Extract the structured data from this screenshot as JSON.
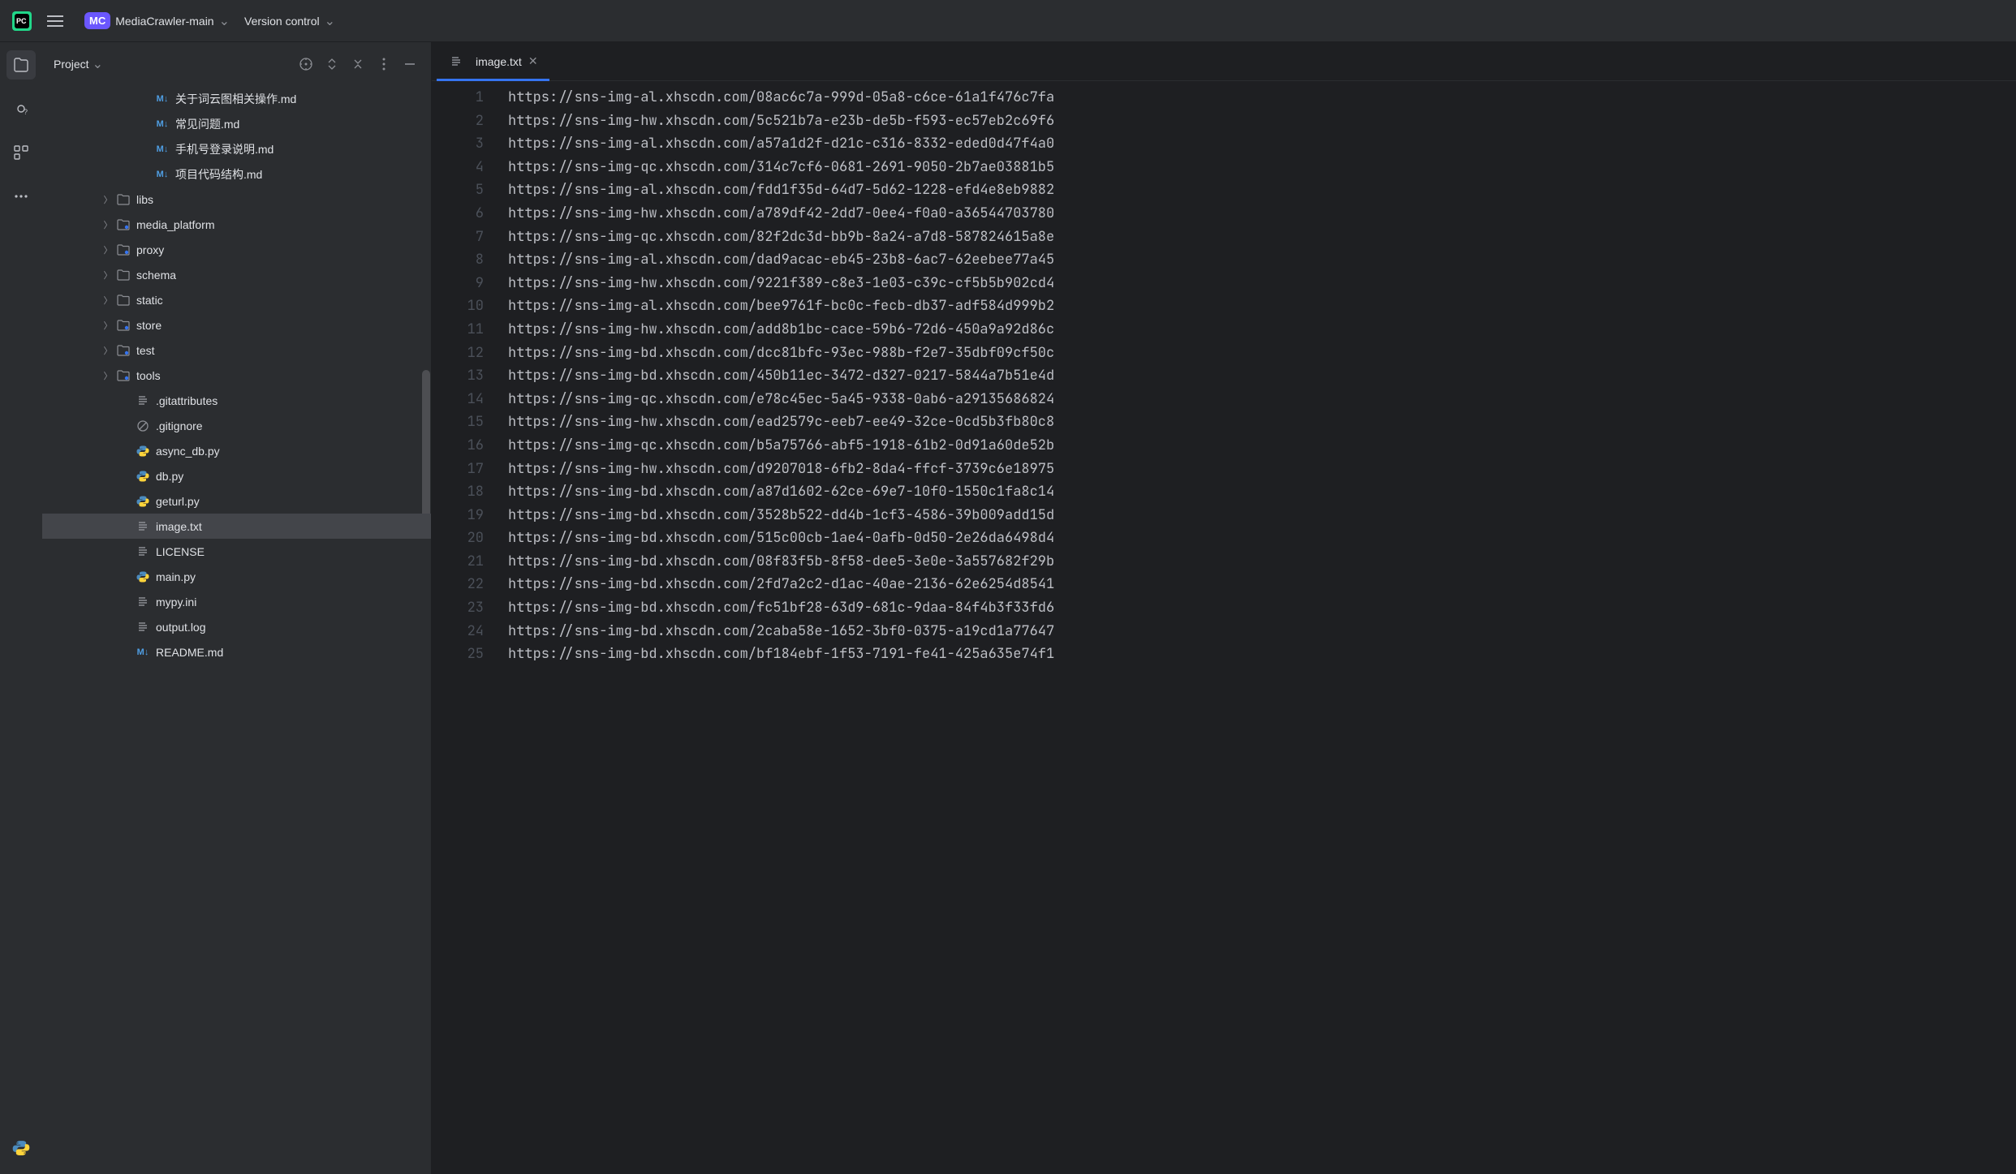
{
  "titlebar": {
    "project_badge": "MC",
    "project_name": "MediaCrawler-main",
    "vcs_label": "Version control"
  },
  "panel": {
    "title": "Project"
  },
  "tree": [
    {
      "indent": 5,
      "icon": "md",
      "name": "关于词云图相关操作.md",
      "twisty": ""
    },
    {
      "indent": 5,
      "icon": "md",
      "name": "常见问题.md",
      "twisty": ""
    },
    {
      "indent": 5,
      "icon": "md",
      "name": "手机号登录说明.md",
      "twisty": ""
    },
    {
      "indent": 5,
      "icon": "md",
      "name": "项目代码结构.md",
      "twisty": ""
    },
    {
      "indent": 3,
      "icon": "folder",
      "name": "libs",
      "twisty": ">"
    },
    {
      "indent": 3,
      "icon": "folder-src",
      "name": "media_platform",
      "twisty": ">"
    },
    {
      "indent": 3,
      "icon": "folder-src",
      "name": "proxy",
      "twisty": ">"
    },
    {
      "indent": 3,
      "icon": "folder",
      "name": "schema",
      "twisty": ">"
    },
    {
      "indent": 3,
      "icon": "folder",
      "name": "static",
      "twisty": ">"
    },
    {
      "indent": 3,
      "icon": "folder-src",
      "name": "store",
      "twisty": ">"
    },
    {
      "indent": 3,
      "icon": "folder-src",
      "name": "test",
      "twisty": ">"
    },
    {
      "indent": 3,
      "icon": "folder-src",
      "name": "tools",
      "twisty": ">"
    },
    {
      "indent": 4,
      "icon": "txt",
      "name": ".gitattributes",
      "twisty": ""
    },
    {
      "indent": 4,
      "icon": "gitignore",
      "name": ".gitignore",
      "twisty": ""
    },
    {
      "indent": 4,
      "icon": "py",
      "name": "async_db.py",
      "twisty": ""
    },
    {
      "indent": 4,
      "icon": "py",
      "name": "db.py",
      "twisty": ""
    },
    {
      "indent": 4,
      "icon": "py",
      "name": "geturl.py",
      "twisty": ""
    },
    {
      "indent": 4,
      "icon": "txt",
      "name": "image.txt",
      "twisty": "",
      "selected": true
    },
    {
      "indent": 4,
      "icon": "txt",
      "name": "LICENSE",
      "twisty": ""
    },
    {
      "indent": 4,
      "icon": "py",
      "name": "main.py",
      "twisty": ""
    },
    {
      "indent": 4,
      "icon": "txt",
      "name": "mypy.ini",
      "twisty": ""
    },
    {
      "indent": 4,
      "icon": "txt",
      "name": "output.log",
      "twisty": ""
    },
    {
      "indent": 4,
      "icon": "md",
      "name": "README.md",
      "twisty": ""
    }
  ],
  "editor": {
    "tab_name": "image.txt",
    "lines": [
      "https://sns-img-al.xhscdn.com/08ac6c7a-999d-05a8-c6ce-61a1f476c7fa",
      "https://sns-img-hw.xhscdn.com/5c521b7a-e23b-de5b-f593-ec57eb2c69f6",
      "https://sns-img-al.xhscdn.com/a57a1d2f-d21c-c316-8332-eded0d47f4a0",
      "https://sns-img-qc.xhscdn.com/314c7cf6-0681-2691-9050-2b7ae03881b5",
      "https://sns-img-al.xhscdn.com/fdd1f35d-64d7-5d62-1228-efd4e8eb9882",
      "https://sns-img-hw.xhscdn.com/a789df42-2dd7-0ee4-f0a0-a36544703780",
      "https://sns-img-qc.xhscdn.com/82f2dc3d-bb9b-8a24-a7d8-587824615a8e",
      "https://sns-img-al.xhscdn.com/dad9acac-eb45-23b8-6ac7-62eebee77a45",
      "https://sns-img-hw.xhscdn.com/9221f389-c8e3-1e03-c39c-cf5b5b902cd4",
      "https://sns-img-al.xhscdn.com/bee9761f-bc0c-fecb-db37-adf584d999b2",
      "https://sns-img-hw.xhscdn.com/add8b1bc-cace-59b6-72d6-450a9a92d86c",
      "https://sns-img-bd.xhscdn.com/dcc81bfc-93ec-988b-f2e7-35dbf09cf50c",
      "https://sns-img-bd.xhscdn.com/450b11ec-3472-d327-0217-5844a7b51e4d",
      "https://sns-img-qc.xhscdn.com/e78c45ec-5a45-9338-0ab6-a29135686824",
      "https://sns-img-hw.xhscdn.com/ead2579c-eeb7-ee49-32ce-0cd5b3fb80c8",
      "https://sns-img-qc.xhscdn.com/b5a75766-abf5-1918-61b2-0d91a60de52b",
      "https://sns-img-hw.xhscdn.com/d9207018-6fb2-8da4-ffcf-3739c6e18975",
      "https://sns-img-bd.xhscdn.com/a87d1602-62ce-69e7-10f0-1550c1fa8c14",
      "https://sns-img-bd.xhscdn.com/3528b522-dd4b-1cf3-4586-39b009add15d",
      "https://sns-img-bd.xhscdn.com/515c00cb-1ae4-0afb-0d50-2e26da6498d4",
      "https://sns-img-bd.xhscdn.com/08f83f5b-8f58-dee5-3e0e-3a557682f29b",
      "https://sns-img-bd.xhscdn.com/2fd7a2c2-d1ac-40ae-2136-62e6254d8541",
      "https://sns-img-bd.xhscdn.com/fc51bf28-63d9-681c-9daa-84f4b3f33fd6",
      "https://sns-img-bd.xhscdn.com/2caba58e-1652-3bf0-0375-a19cd1a77647",
      "https://sns-img-bd.xhscdn.com/bf184ebf-1f53-7191-fe41-425a635e74f1"
    ]
  }
}
